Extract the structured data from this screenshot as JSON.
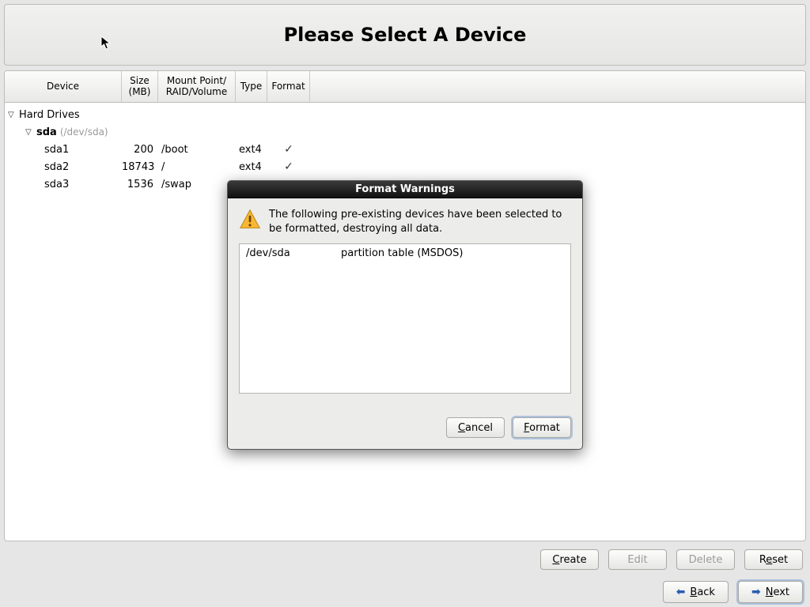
{
  "header": {
    "title": "Please Select A Device"
  },
  "columns": {
    "device": "Device",
    "size": "Size (MB)",
    "mount": "Mount Point/\nRAID/Volume",
    "type": "Type",
    "format": "Format"
  },
  "tree": {
    "root_label": "Hard Drives",
    "disk": {
      "name": "sda",
      "path": "(/dev/sda)"
    },
    "partitions": [
      {
        "name": "sda1",
        "size": "200",
        "mount": "/boot",
        "type": "ext4",
        "format": true
      },
      {
        "name": "sda2",
        "size": "18743",
        "mount": "/",
        "type": "ext4",
        "format": true
      },
      {
        "name": "sda3",
        "size": "1536",
        "mount": "/swap",
        "type": "",
        "format": false
      }
    ]
  },
  "actions": {
    "create": "Create",
    "edit": "Edit",
    "delete": "Delete",
    "reset": "Reset"
  },
  "nav": {
    "back": "Back",
    "next": "Next"
  },
  "dialog": {
    "title": "Format Warnings",
    "message": "The following pre-existing devices have been selected to be formatted, destroying all data.",
    "rows": [
      {
        "device": "/dev/sda",
        "desc": "partition table (MSDOS)"
      }
    ],
    "cancel": "Cancel",
    "format": "Format"
  }
}
